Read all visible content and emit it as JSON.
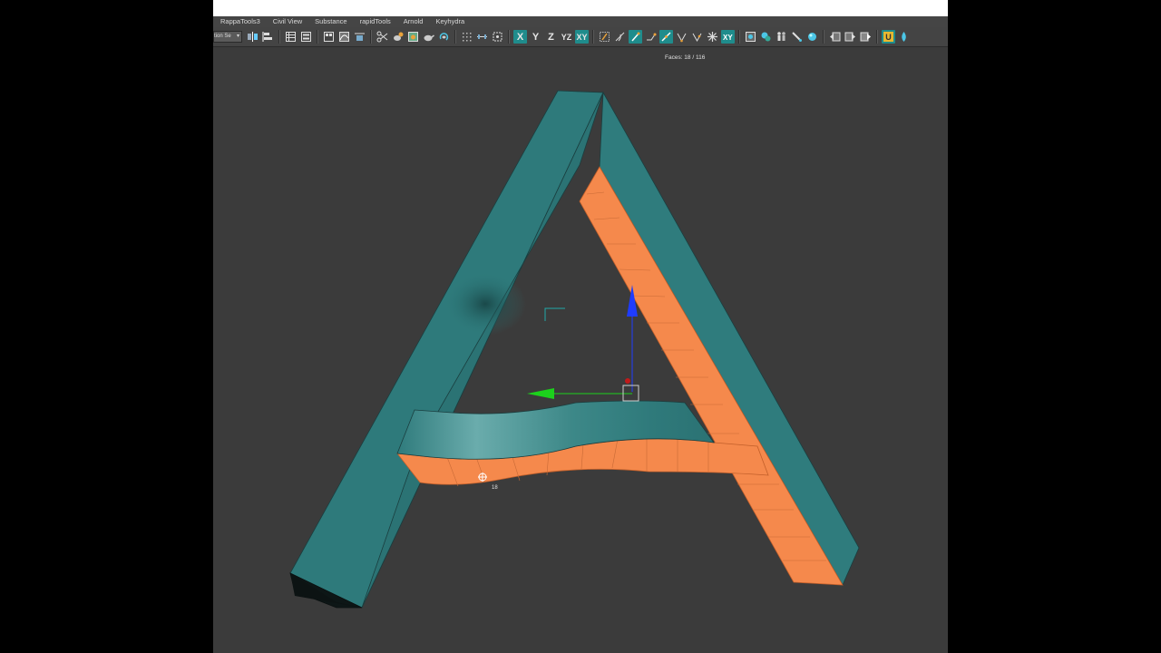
{
  "menubar": {
    "items": [
      "RappaTools3",
      "Civil View",
      "Substance",
      "rapidTools",
      "Arnold",
      "Keyhydra"
    ]
  },
  "toolbar": {
    "selection_set_value": "tion Se",
    "axis_x": "X",
    "axis_y": "Y",
    "axis_z": "Z",
    "axis_yz": "YZ",
    "axis_xy": "XY"
  },
  "viewport": {
    "faces_readout": "Faces: 18 / 116",
    "selection_label": "18"
  },
  "colors": {
    "model": "#2e7a7b",
    "selected_faces": "#f5894c",
    "viewport_bg": "#3b3b3b",
    "active_button": "#1f8c8c"
  }
}
